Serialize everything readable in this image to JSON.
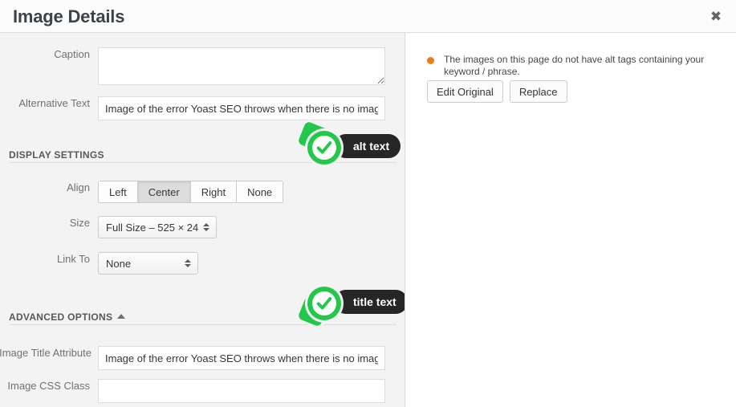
{
  "header": {
    "title": "Image Details",
    "close_label": "✖"
  },
  "form": {
    "caption": {
      "label": "Caption",
      "value": "",
      "placeholder": ""
    },
    "alt_text": {
      "label": "Alternative Text",
      "value": "Image of the error Yoast SEO throws when there is no image ",
      "placeholder": ""
    }
  },
  "display_settings": {
    "heading": "DISPLAY SETTINGS",
    "align": {
      "label": "Align",
      "options": [
        "Left",
        "Center",
        "Right",
        "None"
      ],
      "selected": "Center"
    },
    "size": {
      "label": "Size",
      "selected": "Full Size – 525 × 24"
    },
    "link_to": {
      "label": "Link To",
      "selected": "None"
    }
  },
  "advanced_options": {
    "heading": "ADVANCED OPTIONS",
    "toggle_icon": "caret-up-icon",
    "image_title_attribute": {
      "label": "Image Title Attribute",
      "value": "Image of the error Yoast SEO throws when there is no image ",
      "placeholder": ""
    },
    "image_css_class": {
      "label": "Image CSS Class",
      "value": "",
      "placeholder": ""
    }
  },
  "right_pane": {
    "notice": {
      "text": "The images on this page do not have alt tags containing your keyword / phrase.",
      "bullet_color": "#ee7c1a"
    },
    "buttons": {
      "edit_original": "Edit Original",
      "replace": "Replace"
    }
  },
  "annotations": [
    {
      "label": "alt text",
      "icon": "check-circle-icon",
      "accent": "#23c84b"
    },
    {
      "label": "title text",
      "icon": "check-circle-icon",
      "accent": "#23c84b"
    }
  ]
}
